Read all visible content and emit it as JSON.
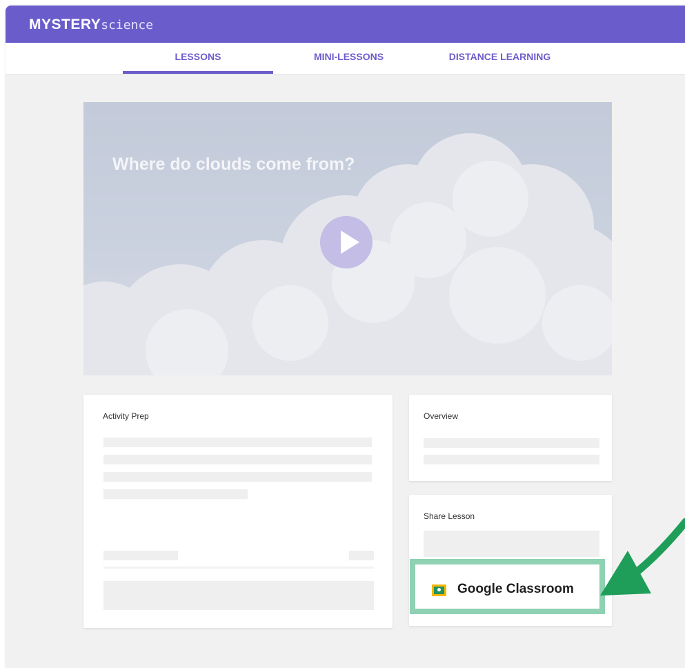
{
  "brand": {
    "name_bold": "MYSTERY",
    "name_light": "science"
  },
  "nav": {
    "tabs": [
      {
        "label": "LESSONS",
        "active": true
      },
      {
        "label": "MINI-LESSONS",
        "active": false
      },
      {
        "label": "DISTANCE LEARNING",
        "active": false
      }
    ]
  },
  "video": {
    "title": "Where do clouds come from?",
    "play_icon": "play-icon"
  },
  "activity_prep": {
    "title": "Activity Prep"
  },
  "overview": {
    "title": "Overview"
  },
  "share": {
    "title": "Share Lesson",
    "google_classroom_label": "Google Classroom",
    "google_classroom_icon": "google-classroom-icon"
  },
  "colors": {
    "brand_purple": "#6b5ccc",
    "highlight_green": "#8ed1b3",
    "arrow_green": "#1f9e5a"
  }
}
